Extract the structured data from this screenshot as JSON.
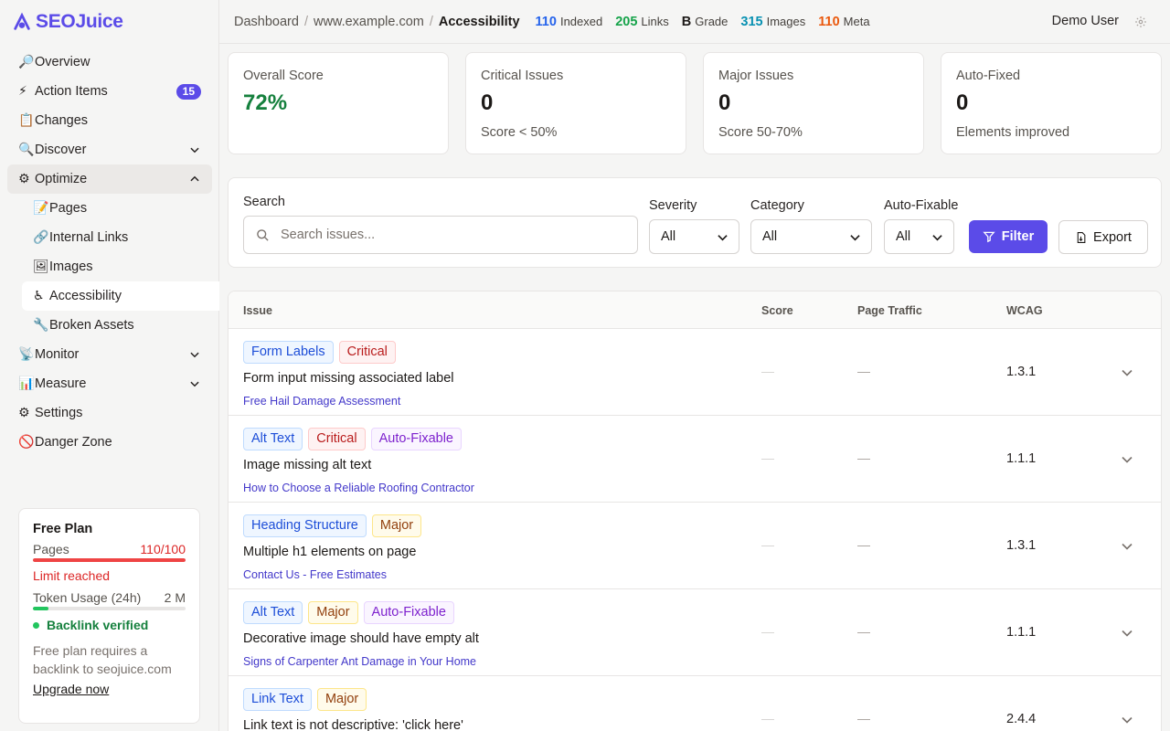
{
  "brand": {
    "name": "SEOJuice"
  },
  "sidebar": {
    "items": [
      {
        "emoji": "🔎",
        "label": "Overview"
      },
      {
        "emoji": "⚡",
        "label": "Action Items",
        "badge": "15"
      },
      {
        "emoji": "📋",
        "label": "Changes"
      },
      {
        "emoji": "🔍",
        "label": "Discover",
        "chevron": "down"
      },
      {
        "emoji": "⚙",
        "label": "Optimize",
        "chevron": "up"
      },
      {
        "emoji": "📝",
        "label": "Pages"
      },
      {
        "emoji": "🔗",
        "label": "Internal Links"
      },
      {
        "emoji": "🖼",
        "label": "Images"
      },
      {
        "emoji": "♿",
        "label": "Accessibility"
      },
      {
        "emoji": "🔧",
        "label": "Broken Assets"
      },
      {
        "emoji": "📡",
        "label": "Monitor",
        "chevron": "down"
      },
      {
        "emoji": "📊",
        "label": "Measure",
        "chevron": "down"
      },
      {
        "emoji": "⚙",
        "label": "Settings"
      },
      {
        "emoji": "🚫",
        "label": "Danger Zone"
      }
    ],
    "active": "Accessibility"
  },
  "plan": {
    "title": "Free Plan",
    "pages_label": "Pages",
    "pages_value": "110/100",
    "pages_fill": 1.0,
    "limit_text": "Limit reached",
    "token_label": "Token Usage (24h)",
    "token_value": "2 M",
    "token_fill": 0.1,
    "verified_text": "Backlink verified",
    "note": "Free plan requires a backlink to seojuice.com",
    "upgrade_label": "Upgrade now"
  },
  "header": {
    "crumbs": [
      "Dashboard",
      "www.example.com",
      "Accessibility"
    ],
    "stats": [
      {
        "value": "110",
        "label": "Indexed",
        "color": "#2563eb"
      },
      {
        "value": "205",
        "label": "Links",
        "color": "#16a34a"
      },
      {
        "value": "B",
        "label": "Grade",
        "color": "#1c1917"
      },
      {
        "value": "315",
        "label": "Images",
        "color": "#0891b2"
      },
      {
        "value": "110",
        "label": "Meta",
        "color": "#ea580c"
      }
    ],
    "user": "Demo User"
  },
  "metrics": [
    {
      "label": "Overall Score",
      "value": "72%",
      "sub": "",
      "color": "#15803d"
    },
    {
      "label": "Critical Issues",
      "value": "0",
      "sub": "Score < 50%",
      "color": "#1c1917"
    },
    {
      "label": "Major Issues",
      "value": "0",
      "sub": "Score 50-70%",
      "color": "#1c1917"
    },
    {
      "label": "Auto-Fixed",
      "value": "0",
      "sub": "Elements improved",
      "color": "#1c1917"
    }
  ],
  "filters": {
    "search_label": "Search",
    "search_placeholder": "Search issues...",
    "severity_label": "Severity",
    "severity_value": "All",
    "category_label": "Category",
    "category_value": "All",
    "autofix_label": "Auto-Fixable",
    "autofix_value": "All",
    "filter_button": "Filter",
    "export_button": "Export"
  },
  "table": {
    "headers": [
      "Issue",
      "Score",
      "Page Traffic",
      "WCAG"
    ],
    "rows": [
      {
        "tags": [
          {
            "text": "Form Labels",
            "kind": "type"
          },
          {
            "text": "Critical",
            "kind": "critical"
          }
        ],
        "title": "Form input missing associated label",
        "page": "Free Hail Damage Assessment",
        "score": "—",
        "traffic": "—",
        "wcag": "1.3.1"
      },
      {
        "tags": [
          {
            "text": "Alt Text",
            "kind": "type"
          },
          {
            "text": "Critical",
            "kind": "critical"
          },
          {
            "text": "Auto-Fixable",
            "kind": "auto"
          }
        ],
        "title": "Image missing alt text",
        "page": "How to Choose a Reliable Roofing Contractor",
        "score": "—",
        "traffic": "—",
        "wcag": "1.1.1"
      },
      {
        "tags": [
          {
            "text": "Heading Structure",
            "kind": "type"
          },
          {
            "text": "Major",
            "kind": "major"
          }
        ],
        "title": "Multiple h1 elements on page",
        "page": "Contact Us - Free Estimates",
        "score": "—",
        "traffic": "—",
        "wcag": "1.3.1"
      },
      {
        "tags": [
          {
            "text": "Alt Text",
            "kind": "type"
          },
          {
            "text": "Major",
            "kind": "major"
          },
          {
            "text": "Auto-Fixable",
            "kind": "auto"
          }
        ],
        "title": "Decorative image should have empty alt",
        "page": "Signs of Carpenter Ant Damage in Your Home",
        "score": "—",
        "traffic": "—",
        "wcag": "1.1.1"
      },
      {
        "tags": [
          {
            "text": "Link Text",
            "kind": "type"
          },
          {
            "text": "Major",
            "kind": "major"
          }
        ],
        "title": "Link text is not descriptive: 'click here'",
        "page": "",
        "score": "—",
        "traffic": "—",
        "wcag": "2.4.4"
      }
    ]
  }
}
